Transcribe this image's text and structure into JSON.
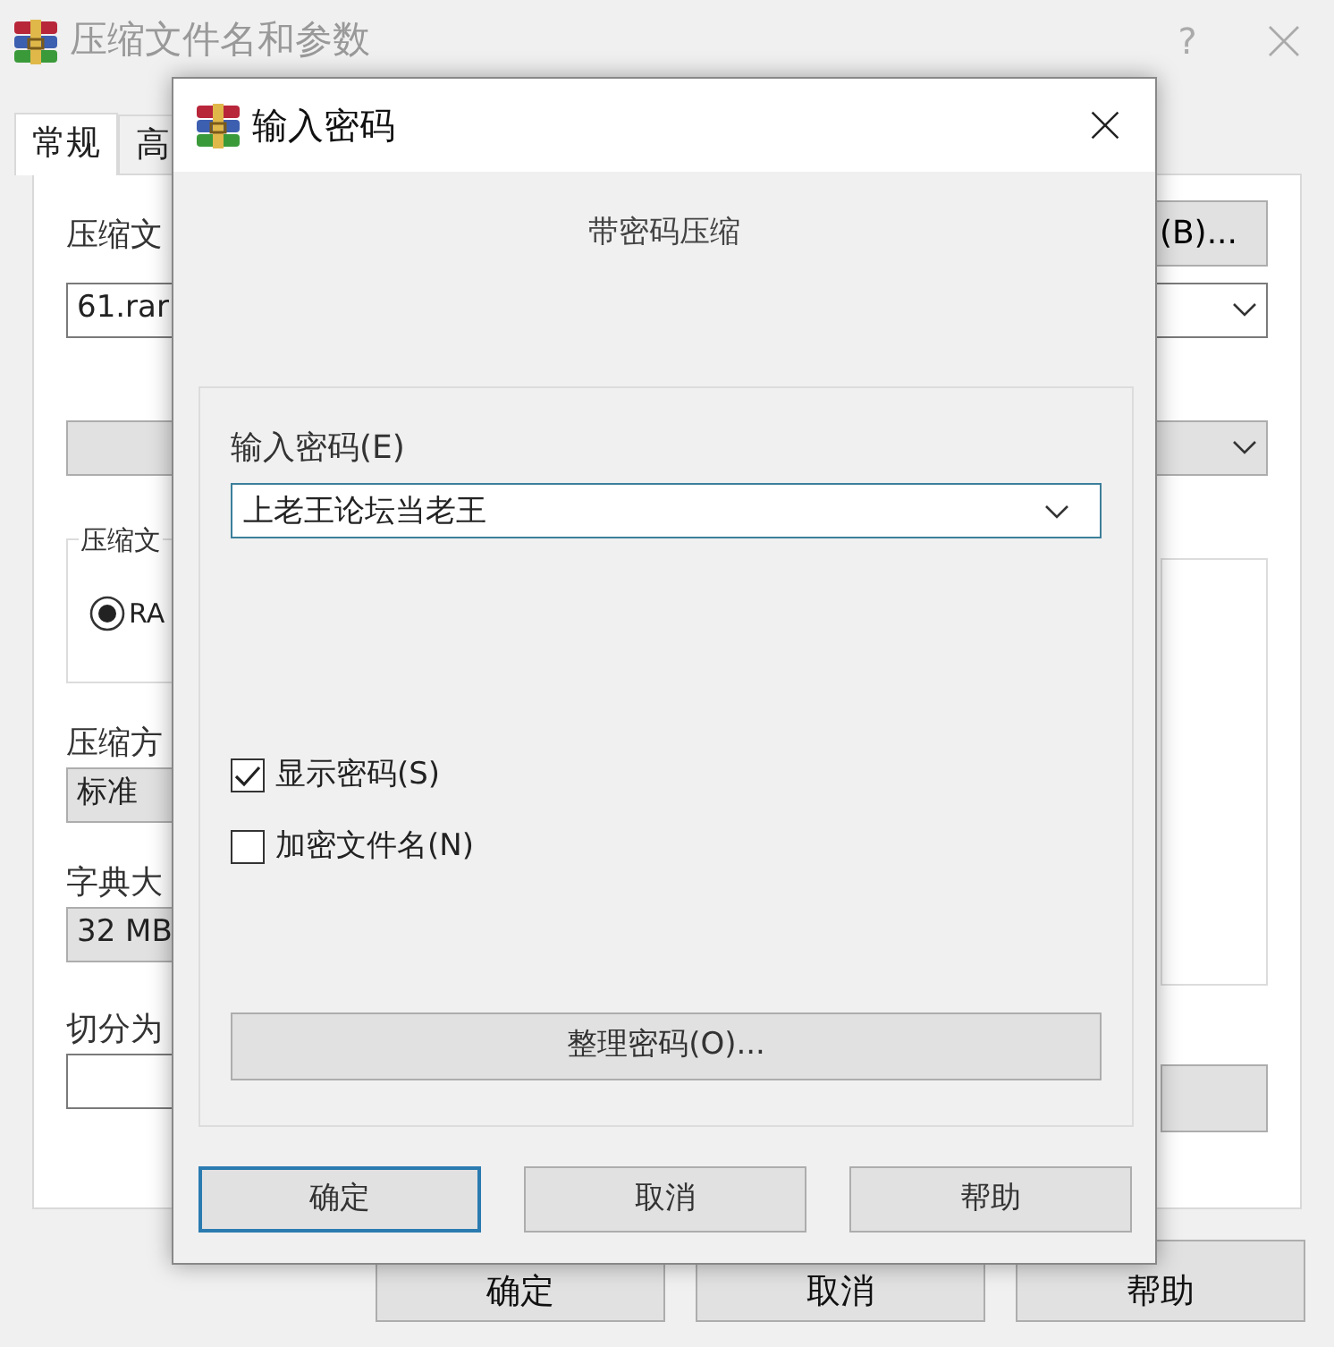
{
  "window": {
    "title": "压缩文件名和参数",
    "help_button": "?"
  },
  "tabs": [
    {
      "label": "常规",
      "selected": true
    },
    {
      "label": "高",
      "selected": false
    }
  ],
  "general": {
    "archive_name_label": "压缩文",
    "browse_button": "(B)...",
    "archive_name": "61.rar",
    "format_group_label": "压缩文",
    "format_options": [
      {
        "label": "RA",
        "selected": true
      }
    ],
    "method_label": "压缩方",
    "method": "标准",
    "dictionary_label": "字典大",
    "dictionary": "32 MB",
    "split_label": "切分为"
  },
  "buttons": [
    "确定",
    "取消",
    "帮助"
  ],
  "dialog": {
    "title": "输入密码",
    "heading": "带密码压缩",
    "password_label": "输入密码(E)",
    "password": "上老王论坛当老王",
    "options": [
      {
        "label": "显示密码(S)",
        "checked": true
      },
      {
        "label": "加密文件名(N)",
        "checked": false
      }
    ],
    "organize_button": "整理密码(O)...",
    "buttons": [
      {
        "label": "确定",
        "default": true
      },
      {
        "label": "取消",
        "default": false
      },
      {
        "label": "帮助",
        "default": false
      }
    ]
  }
}
